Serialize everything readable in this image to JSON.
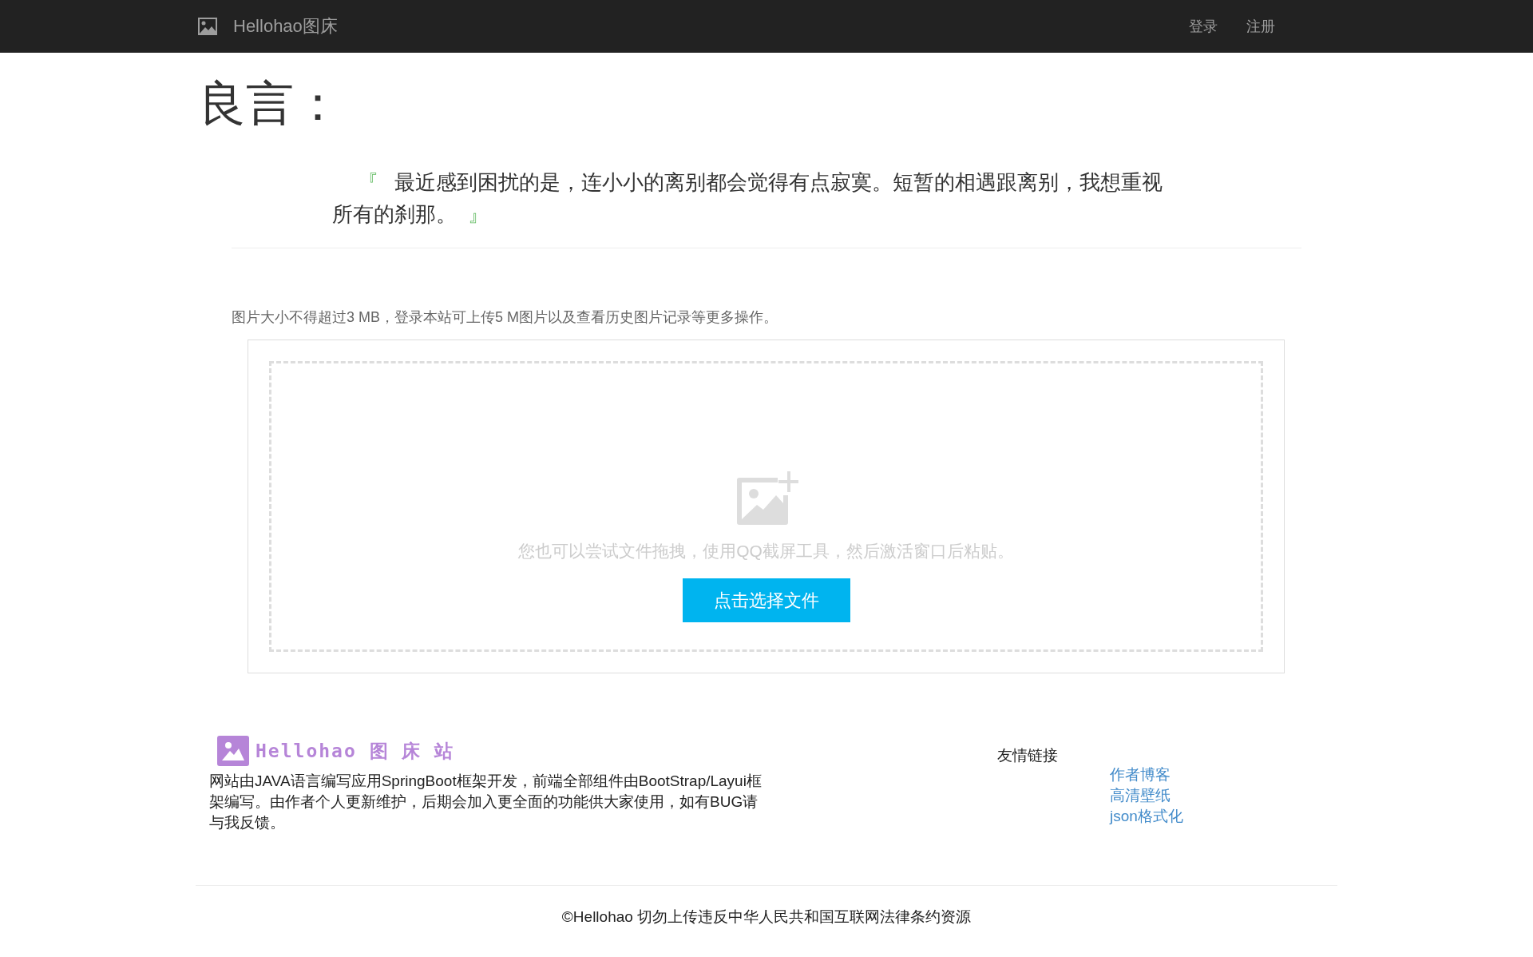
{
  "navbar": {
    "brand": "Hellohao图床",
    "links": [
      "登录",
      "注册"
    ]
  },
  "heading": "良言：",
  "quote": {
    "open": "『",
    "text": "最近感到困扰的是，连小小的离别都会觉得有点寂寞。短暂的相遇跟离别，我想重视所有的刹那。",
    "close": "』"
  },
  "upload": {
    "notice": "图片大小不得超过3 MB，登录本站可上传5 M图片以及查看历史图片记录等更多操作。",
    "hint": "您也可以尝试文件拖拽，使用QQ截屏工具，然后激活窗口后粘贴。",
    "button": "点击选择文件"
  },
  "footer": {
    "logo_text": "Hellohao 图 床 站",
    "description": "网站由JAVA语言编写应用SpringBoot框架开发，前端全部组件由BootStrap/Layui框架编写。由作者个人更新维护，后期会加入更全面的功能供大家使用，如有BUG请与我反馈。",
    "links_title": "友情链接",
    "links": [
      "作者博客",
      "高清壁纸",
      "json格式化"
    ],
    "copyright": "©Hellohao 切勿上传违反中华人民共和国互联网法律条约资源"
  }
}
